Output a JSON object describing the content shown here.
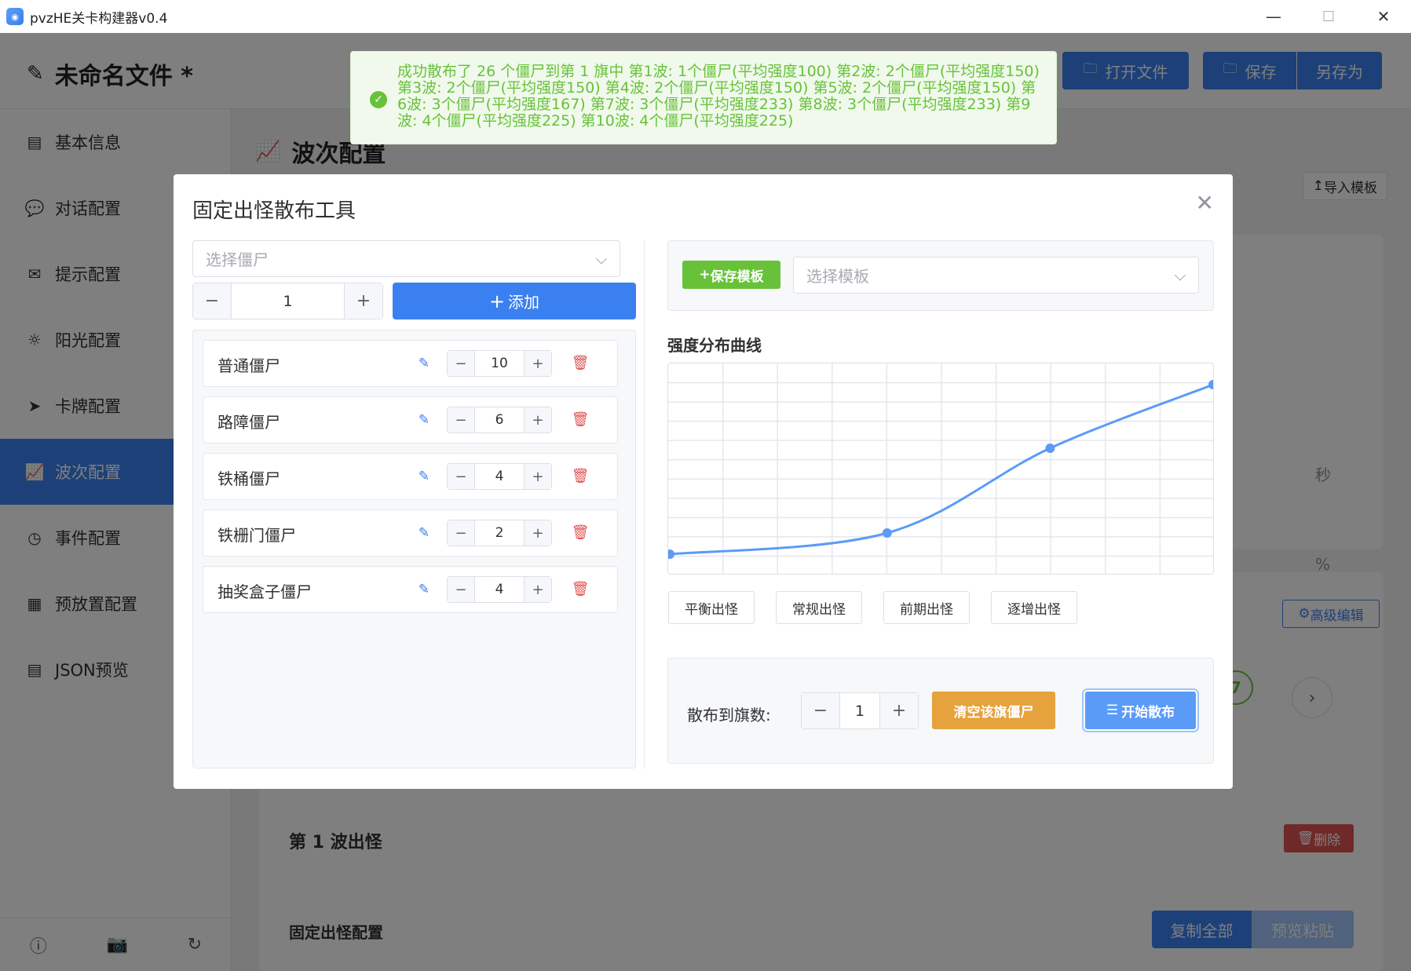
{
  "window": {
    "title": "pvzHE关卡构建器v0.4",
    "minimize": "—",
    "maximize": "☐",
    "close": "✕"
  },
  "header": {
    "file_title": "未命名文件 *",
    "open_file": "打开文件",
    "save": "保存",
    "save_as": "另存为"
  },
  "sidebar": {
    "items": [
      {
        "label": "基本信息",
        "icon": "info-doc-icon"
      },
      {
        "label": "对话配置",
        "icon": "chat-icon"
      },
      {
        "label": "提示配置",
        "icon": "mail-icon"
      },
      {
        "label": "阳光配置",
        "icon": "sun-icon"
      },
      {
        "label": "卡牌配置",
        "icon": "send-icon"
      },
      {
        "label": "波次配置",
        "icon": "chart-icon",
        "active": true
      },
      {
        "label": "事件配置",
        "icon": "clock-icon"
      },
      {
        "label": "预放置配置",
        "icon": "grid-icon"
      },
      {
        "label": "JSON预览",
        "icon": "document-icon"
      }
    ]
  },
  "main": {
    "panel_title": "波次配置",
    "import_template": "导入模板",
    "side_unit_seconds": "秒",
    "side_unit_percent": "%",
    "advanced_edit": "高级编辑",
    "wave_title": "第 1 波出怪",
    "delete": "删除",
    "fixed_title": "固定出怪配置",
    "copy_all": "复制全部",
    "preview_paste": "预览粘贴",
    "circle_badge": "7"
  },
  "toast": {
    "message": "成功散布了 26 个僵尸到第 1 旗中 第1波: 1个僵尸(平均强度100) 第2波: 2个僵尸(平均强度150) 第3波: 2个僵尸(平均强度150) 第4波: 2个僵尸(平均强度150) 第5波: 2个僵尸(平均强度150) 第6波: 3个僵尸(平均强度167) 第7波: 3个僵尸(平均强度233) 第8波: 3个僵尸(平均强度233) 第9波: 4个僵尸(平均强度225) 第10波: 4个僵尸(平均强度225)"
  },
  "modal": {
    "title": "固定出怪散布工具",
    "zombie_select_placeholder": "选择僵尸",
    "add_count": "1",
    "add_button": "添加",
    "zombies": [
      {
        "name": "普通僵尸",
        "count": "10"
      },
      {
        "name": "路障僵尸",
        "count": "6"
      },
      {
        "name": "铁桶僵尸",
        "count": "4"
      },
      {
        "name": "铁栅门僵尸",
        "count": "2"
      },
      {
        "name": "抽奖盒子僵尸",
        "count": "4"
      }
    ],
    "save_template": "保存模板",
    "template_select_placeholder": "选择模板",
    "curve_title": "强度分布曲线",
    "presets": [
      "平衡出怪",
      "常规出怪",
      "前期出怪",
      "逐增出怪"
    ],
    "distribute_label": "散布到旗数:",
    "flag_count": "1",
    "clear_button": "清空该旗僵尸",
    "start_button": "开始散布"
  },
  "chart_data": {
    "type": "line",
    "control_points": [
      {
        "x": 0,
        "y": 0.1
      },
      {
        "x": 0.4,
        "y": 0.2
      },
      {
        "x": 0.7,
        "y": 0.6
      },
      {
        "x": 1.0,
        "y": 0.9
      }
    ],
    "xlim": [
      0,
      1
    ],
    "ylim": [
      0,
      1
    ],
    "grid": true,
    "color": "#5b9bf8"
  },
  "colors": {
    "primary": "#3a80f0",
    "success": "#67c23a",
    "warning": "#e6a23c",
    "danger": "#e05252"
  }
}
